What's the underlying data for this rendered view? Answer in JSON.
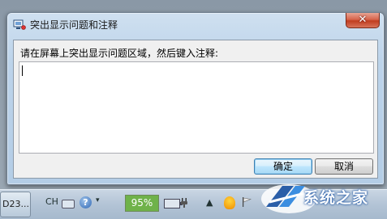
{
  "dialog": {
    "title": "突出显示问题和注释",
    "close_glyph": "✕",
    "prompt": "请在屏幕上突出显示问题区域，然后键入注释:",
    "notes_value": "",
    "ok_label": "确定",
    "cancel_label": "取消"
  },
  "taskbar": {
    "task_button_text": "D23...",
    "language": "CH",
    "help_glyph": "?",
    "menu_chevron": "▾",
    "battery_percent": "95%",
    "tray_up_glyph": "▲",
    "icons": [
      "app-recorder-icon",
      "keyboard-icon",
      "help-icon",
      "battery-icon",
      "plug-icon",
      "qq-icon",
      "flag-icon"
    ]
  },
  "watermark": {
    "text": "系统之家"
  },
  "colors": {
    "title_gradient": "#cfe0f0",
    "close_red": "#c03d20",
    "ok_accent": "#3c7fb1",
    "battery_green": "#6fb24a",
    "watermark_blue": "#2a5ea8"
  }
}
